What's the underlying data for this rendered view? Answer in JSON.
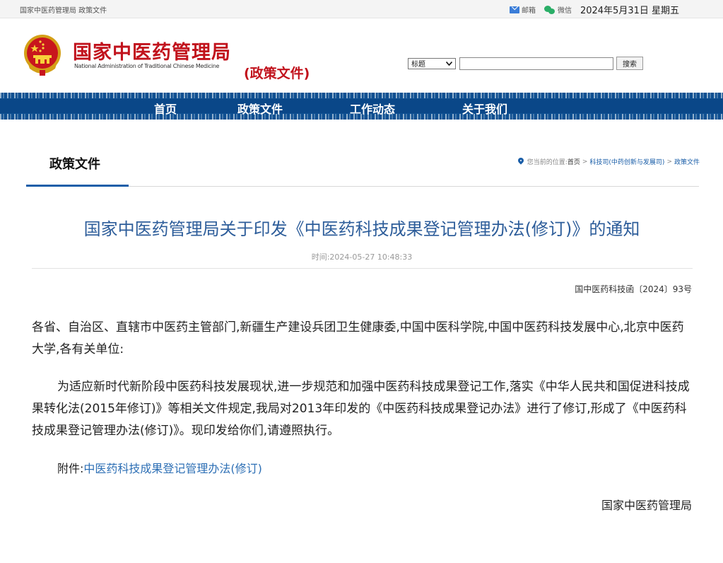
{
  "topbar": {
    "crumb": "国家中医药管理局 政策文件",
    "mail_label": "邮箱",
    "wechat_label": "微信",
    "date": "2024年5月31日 星期五"
  },
  "header": {
    "brand_cn": "国家中医药管理局",
    "brand_en": "National Administration of Traditional Chinese Medicine",
    "section_tag": "(政策文件)",
    "search_scope": "标题",
    "search_value": "",
    "search_button": "搜索"
  },
  "nav": {
    "items": [
      "首页",
      "政策文件",
      "工作动态",
      "关于我们"
    ]
  },
  "section": {
    "title": "政策文件",
    "location_label": "您当前的位置:",
    "location_home": "首页",
    "location_dept": "科技司(中药创新与发展司)",
    "location_current": "政策文件"
  },
  "article": {
    "title": "国家中医药管理局关于印发《中医药科技成果登记管理办法(修订)》的通知",
    "time": "时间:2024-05-27 10:48:33",
    "doc_number": "国中医药科技函〔2024〕93号",
    "addressee": "各省、自治区、直辖市中医药主管部门,新疆生产建设兵团卫生健康委,中国中医科学院,中国中医药科技发展中心,北京中医药大学,各有关单位:",
    "body": "为适应新时代新阶段中医药科技发展现状,进一步规范和加强中医药科技成果登记工作,落实《中华人民共和国促进科技成果转化法(2015年修订)》等相关文件规定,我局对2013年印发的《中医药科技成果登记办法》进行了修订,形成了《中医药科技成果登记管理办法(修订)》。现印发给你们,请遵照执行。",
    "attachment_label": "附件:",
    "attachment_link": "中医药科技成果登记管理办法(修订)",
    "signature": "国家中医药管理局"
  },
  "colors": {
    "brand_red": "#c1121c",
    "nav_blue": "#0e4f91",
    "title_blue": "#2d5d9a",
    "link_blue": "#2d6fb5"
  }
}
